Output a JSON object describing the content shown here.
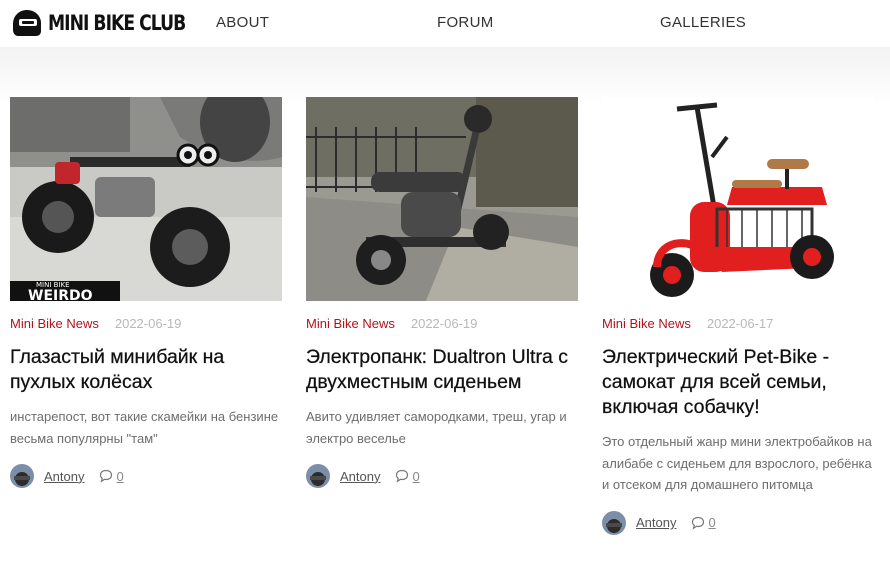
{
  "brand": {
    "name": "MINI BIKE CLUB",
    "logo_icon": "helmet-logo-icon"
  },
  "nav": [
    {
      "label": "ABOUT"
    },
    {
      "label": "FORUM"
    },
    {
      "label": "GALLERIES"
    }
  ],
  "colors": {
    "accent": "#b3131b",
    "date": "#b8b8b8",
    "excerpt": "#6d6d6d"
  },
  "posts": [
    {
      "category": "Mini Bike News",
      "date": "2022-06-19",
      "title": "Глазастый минибайк на пухлых колёсах",
      "excerpt": "инстарепост, вот такие скамейки на бензине весьма популярны \"там\"",
      "author": "Antony",
      "comments": "0",
      "image_caption": "WEIRDO",
      "image_caption_small": "MINI BIKE"
    },
    {
      "category": "Mini Bike News",
      "date": "2022-06-19",
      "title": "Электропанк: Dualtron Ultra с двухместным сиденьем",
      "excerpt": "Авито удивляет самородками, треш, угар и электро веселье",
      "author": "Antony",
      "comments": "0"
    },
    {
      "category": "Mini Bike News",
      "date": "2022-06-17",
      "title": "Электрический Pet-Bike - самокат для всей семьи, включая собачку!",
      "excerpt": "Это отдельный жанр мини электробайков на алибабе с сиденьем для взрослого, ребёнка и отсеком для домашнего питомца",
      "author": "Antony",
      "comments": "0"
    }
  ]
}
